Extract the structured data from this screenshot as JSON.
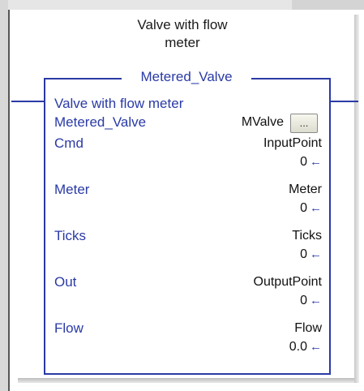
{
  "block": {
    "title_line1": "Valve with flow",
    "title_line2": "meter",
    "instance_name": "Metered_Valve",
    "description": "Valve with flow meter",
    "operand": {
      "label": "Metered_Valve",
      "tag": "MValve",
      "button_label": "..."
    },
    "params": [
      {
        "label": "Cmd",
        "tag": "InputPoint",
        "value": "0"
      },
      {
        "label": "Meter",
        "tag": "Meter",
        "value": "0"
      },
      {
        "label": "Ticks",
        "tag": "Ticks",
        "value": "0"
      },
      {
        "label": "Out",
        "tag": "OutputPoint",
        "value": "0"
      },
      {
        "label": "Flow",
        "tag": "Flow",
        "value": "0.0"
      }
    ],
    "arrow_glyph": "←"
  },
  "colors": {
    "wire": "#2a3aa6",
    "label": "#2a3aa6",
    "text": "#111111",
    "background": "#ffffff"
  }
}
